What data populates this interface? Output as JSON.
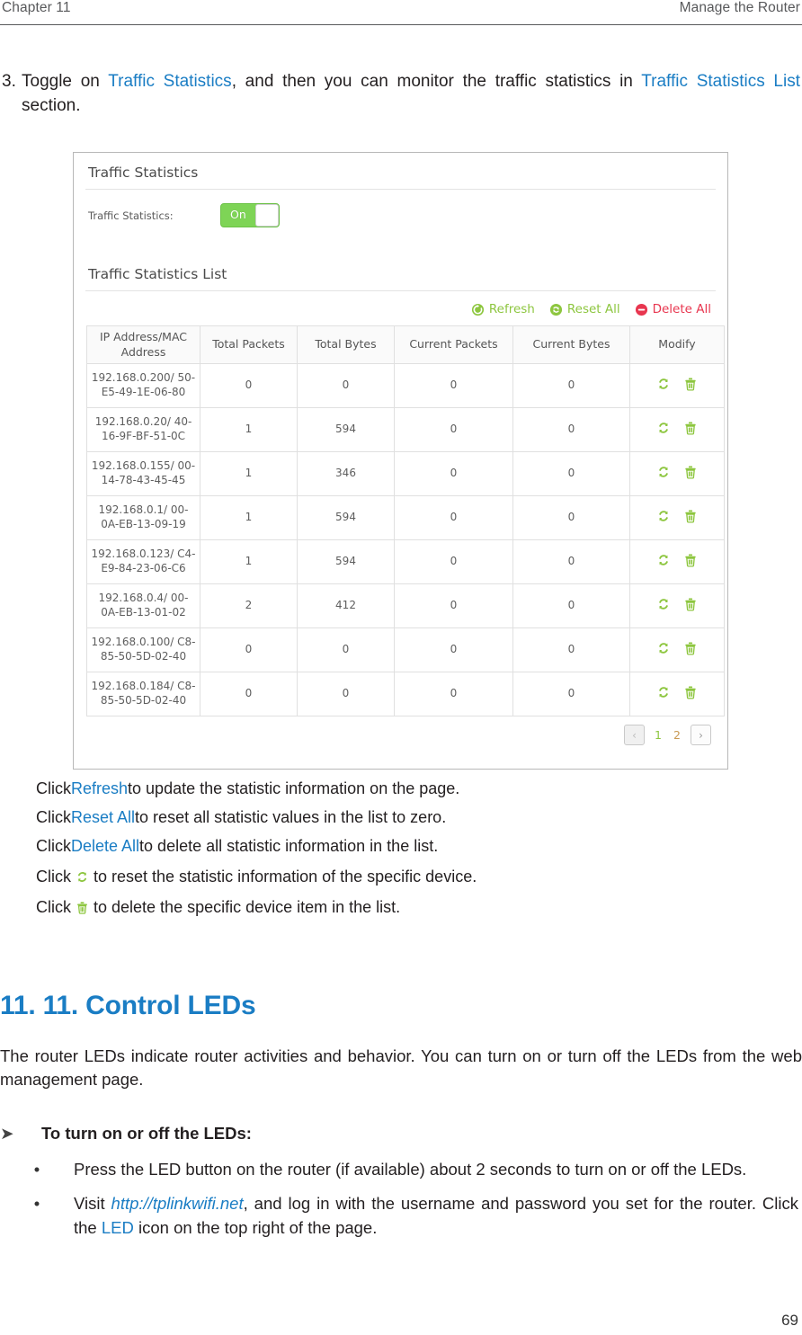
{
  "header": {
    "chapter": "Chapter 11",
    "section": "Manage the Router"
  },
  "step": {
    "number": "3.",
    "text_1": "Toggle on ",
    "link_1": "Traffic Statistics",
    "text_2": ", and then you can monitor the traffic statistics in ",
    "link_2": "Traffic Statistics List",
    "text_3": " section."
  },
  "router_ui": {
    "section_title": "Traffic Statistics",
    "field_label": "Traffic Statistics:",
    "toggle_value": "On",
    "list_title": "Traffic Statistics List",
    "actions": [
      {
        "label": "Refresh",
        "icon": "refresh-icon",
        "color": "#8dc63f"
      },
      {
        "label": "Reset All",
        "icon": "reset-icon",
        "color": "#8dc63f"
      },
      {
        "label": "Delete All",
        "icon": "delete-icon",
        "color": "#e8364f"
      }
    ],
    "table": {
      "columns": [
        "IP Address/MAC Address",
        "Total Packets",
        "Total Bytes",
        "Current Packets",
        "Current Bytes",
        "Modify"
      ],
      "rows": [
        {
          "ip": "192.168.0.200/ 50-E5-49-1E-06-80",
          "total_packets": "0",
          "total_bytes": "0",
          "current_packets": "0",
          "current_bytes": "0"
        },
        {
          "ip": "192.168.0.20/ 40-16-9F-BF-51-0C",
          "total_packets": "1",
          "total_bytes": "594",
          "current_packets": "0",
          "current_bytes": "0"
        },
        {
          "ip": "192.168.0.155/ 00-14-78-43-45-45",
          "total_packets": "1",
          "total_bytes": "346",
          "current_packets": "0",
          "current_bytes": "0"
        },
        {
          "ip": "192.168.0.1/ 00-0A-EB-13-09-19",
          "total_packets": "1",
          "total_bytes": "594",
          "current_packets": "0",
          "current_bytes": "0"
        },
        {
          "ip": "192.168.0.123/ C4-E9-84-23-06-C6",
          "total_packets": "1",
          "total_bytes": "594",
          "current_packets": "0",
          "current_bytes": "0"
        },
        {
          "ip": "192.168.0.4/ 00-0A-EB-13-01-02",
          "total_packets": "2",
          "total_bytes": "412",
          "current_packets": "0",
          "current_bytes": "0"
        },
        {
          "ip": "192.168.0.100/ C8-85-50-5D-02-40",
          "total_packets": "0",
          "total_bytes": "0",
          "current_packets": "0",
          "current_bytes": "0"
        },
        {
          "ip": "192.168.0.184/ C8-85-50-5D-02-40",
          "total_packets": "0",
          "total_bytes": "0",
          "current_packets": "0",
          "current_bytes": "0"
        }
      ]
    },
    "pagination": {
      "prev": "‹",
      "next": "›",
      "pages": [
        "1",
        "2"
      ],
      "active_page": "1"
    }
  },
  "click_list": [
    {
      "pre": "Click ",
      "link": "Refresh",
      "post": " to update the statistic information on the page.",
      "icon": null
    },
    {
      "pre": "Click ",
      "link": "Reset All",
      "post": " to reset all statistic values in the list to zero.",
      "icon": null
    },
    {
      "pre": "Click ",
      "link": "Delete All",
      "post": " to delete all statistic information in the list.",
      "icon": null
    },
    {
      "pre": "Click ",
      "link": null,
      "post": " to reset the statistic information of the specific device.",
      "icon": "reset-icon"
    },
    {
      "pre": "Click ",
      "link": null,
      "post": " to delete the specific device item in the list.",
      "icon": "delete-bin-icon"
    }
  ],
  "chapter": {
    "heading": "11. 11.  Control LEDs",
    "intro": "The router LEDs indicate router activities and behavior. You can  turn on or turn off the LEDs from the web management page.",
    "arrow_glyph": "➤",
    "arrow_heading": "To turn on or off the LEDs:",
    "bullets": [
      {
        "dot": "•",
        "pre": "Press the LED button on the router (if available) about 2 seconds to turn on or off the LEDs.",
        "link": null,
        "post": ""
      },
      {
        "dot": "•",
        "pre": "Visit ",
        "link": "http://tplinkwifi.net",
        "mid": ", and log in with the username and password you set for the router. Click the ",
        "link2": "LED",
        "post": " icon on the top right of the page."
      }
    ]
  },
  "footer": {
    "page_number": "69"
  },
  "colors": {
    "link": "#1a7dc4",
    "green": "#8dc63f",
    "red": "#e8364f",
    "toggle_on": "#7ed456"
  }
}
